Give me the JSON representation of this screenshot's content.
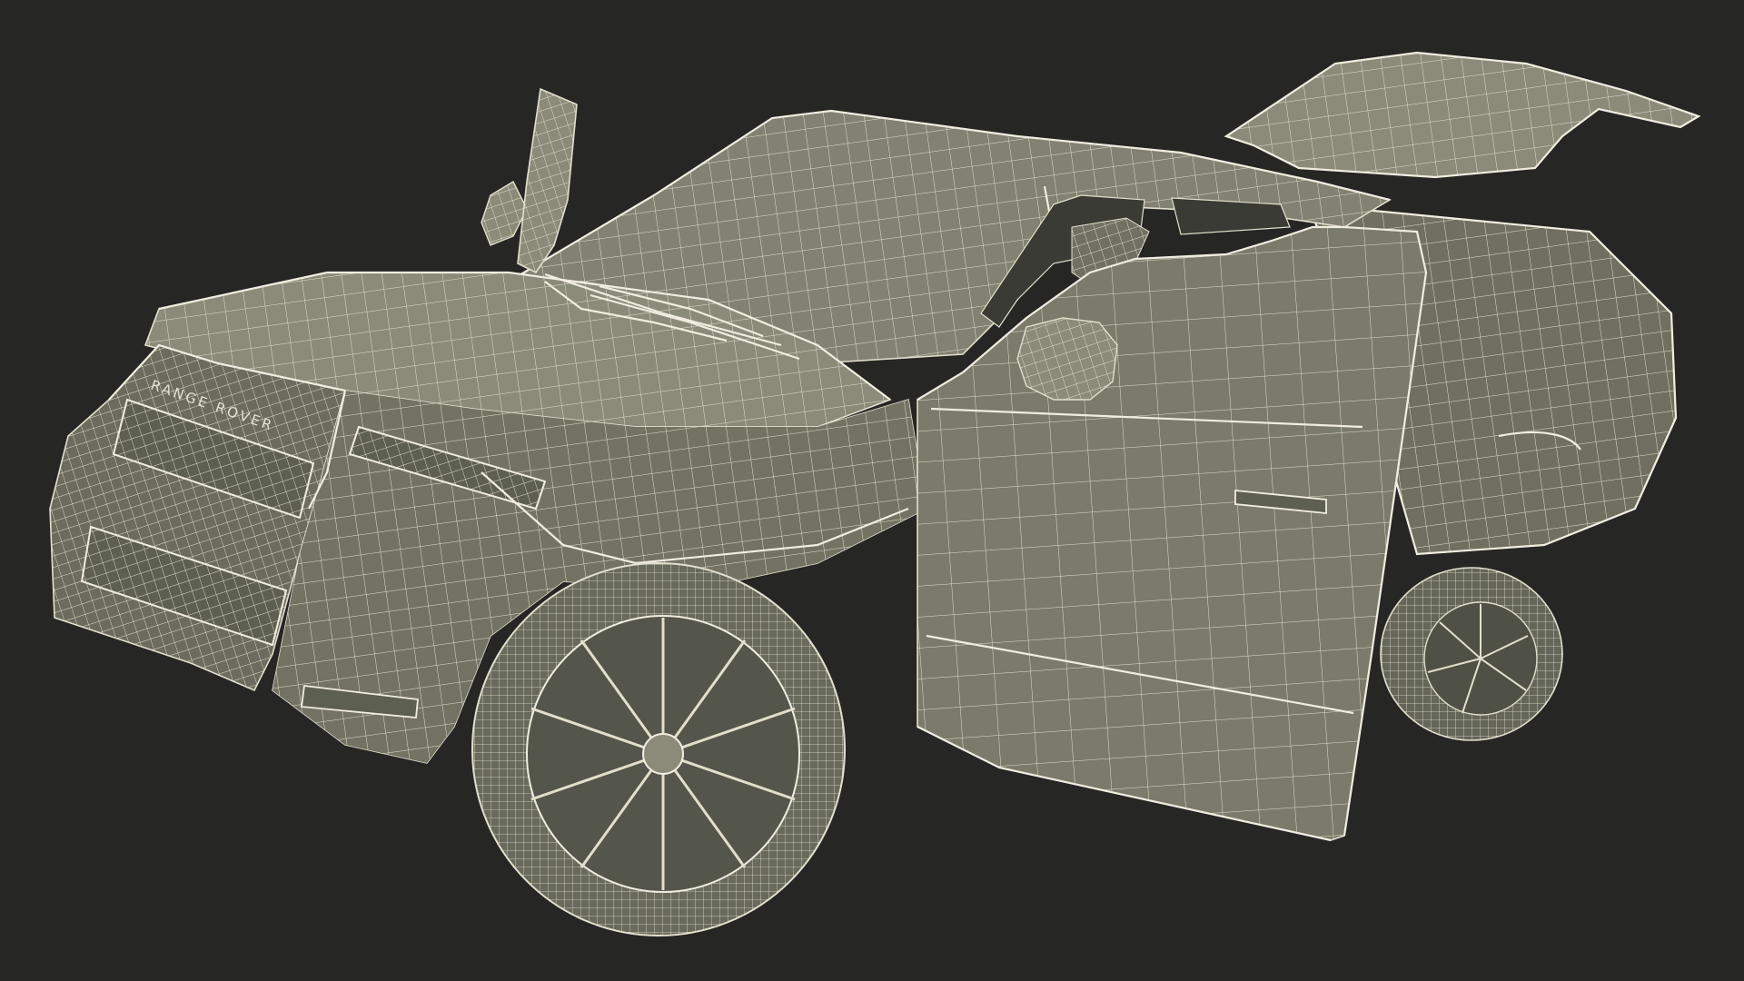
{
  "scene": {
    "background": "#262625",
    "model": {
      "fill_color": "#7a7b6a",
      "fill_dark": "#5d5f50",
      "fill_light": "#8e8f7d",
      "wire_color": "#e2dfcc",
      "badge_text": "RANGE ROVER"
    }
  }
}
